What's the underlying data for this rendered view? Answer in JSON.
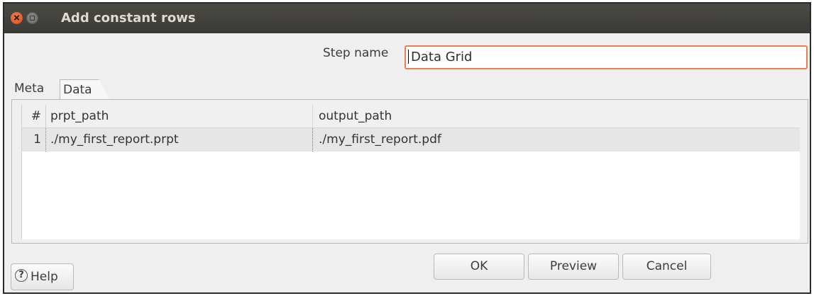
{
  "window": {
    "title": "Add constant rows"
  },
  "step": {
    "label": "Step name",
    "value": "Data Grid"
  },
  "tabs": [
    {
      "label": "Meta"
    },
    {
      "label": "Data"
    }
  ],
  "grid": {
    "columns": [
      "#",
      "prpt_path",
      "output_path"
    ],
    "rows": [
      {
        "num": "1",
        "prpt_path": "./my_first_report.prpt",
        "output_path": "./my_first_report.pdf"
      }
    ]
  },
  "buttons": {
    "help": "Help",
    "ok": "OK",
    "preview": "Preview",
    "cancel": "Cancel"
  },
  "icons": {
    "close": "close-icon",
    "minimize": "minimize-icon",
    "help": "question-circle-icon"
  },
  "colors": {
    "titlebar": "#3f3e3a",
    "close": "#e5531d",
    "input_focus": "#e8804f"
  }
}
